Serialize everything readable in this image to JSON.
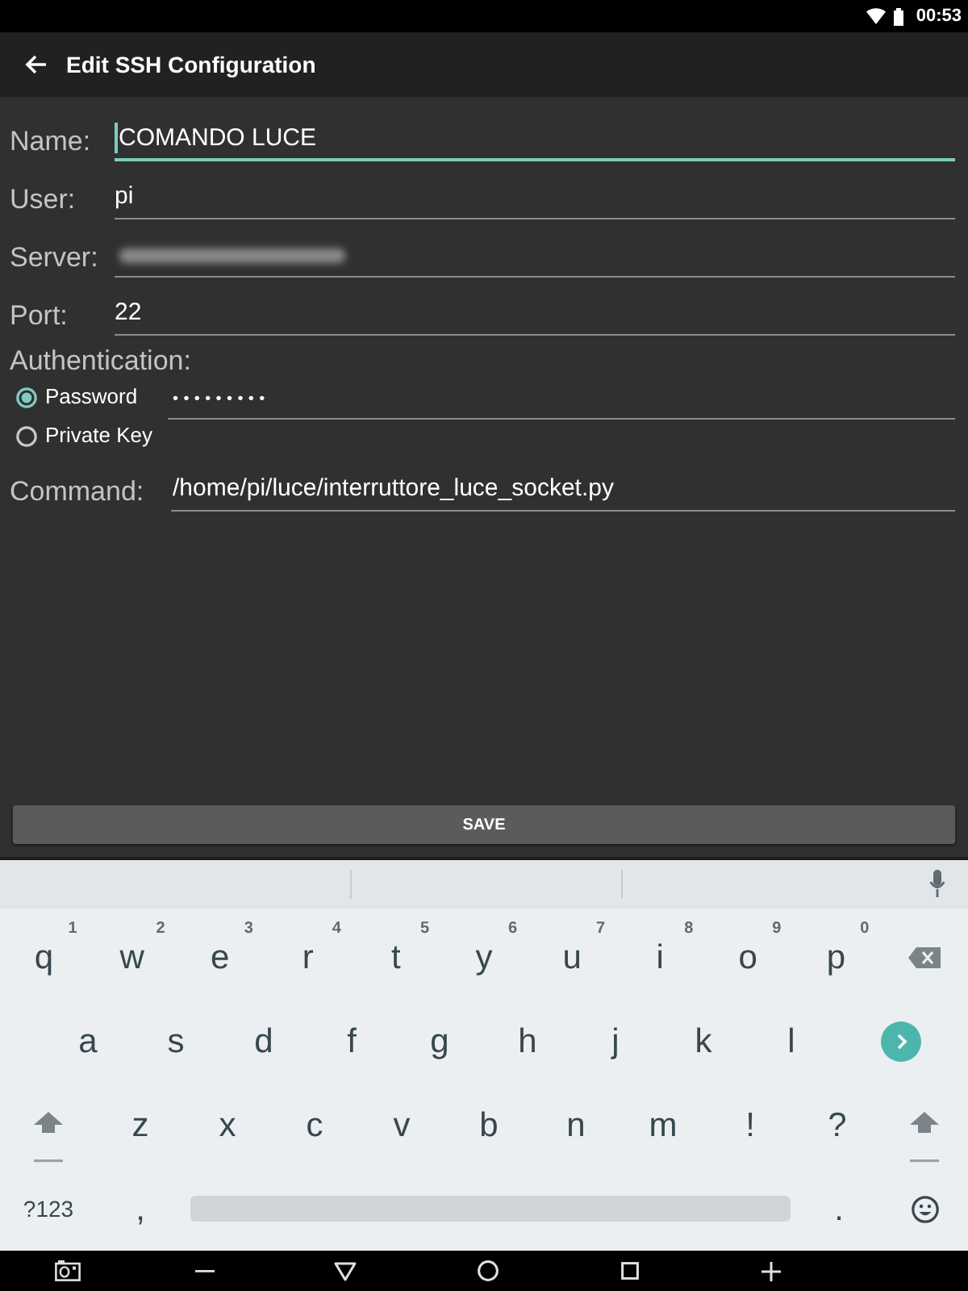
{
  "status_bar": {
    "time": "00:53"
  },
  "toolbar": {
    "title": "Edit SSH Configuration"
  },
  "fields": [
    {
      "label": "Name:",
      "value": "COMANDO LUCE",
      "focused": true,
      "blurred": false
    },
    {
      "label": "User:",
      "value": "pi",
      "focused": false,
      "blurred": false
    },
    {
      "label": "Server:",
      "focused": false,
      "blurred": true
    },
    {
      "label": "Port:",
      "value": "22",
      "focused": false,
      "blurred": false
    }
  ],
  "authentication": {
    "label": "Authentication:",
    "options": [
      {
        "label": "Password",
        "selected": true
      },
      {
        "label": "Private Key",
        "selected": false
      }
    ],
    "password": "•••••••••"
  },
  "command": {
    "label": "Command:",
    "value": "/home/pi/luce/interruttore_luce_socket.py"
  },
  "save_button": "SAVE",
  "keyboard": {
    "key_rows": [
      {
        "keys": [
          {
            "kind": "char",
            "label": "q",
            "hint": "1"
          },
          {
            "kind": "char",
            "label": "w",
            "hint": "2"
          },
          {
            "kind": "char",
            "label": "e",
            "hint": "3"
          },
          {
            "kind": "char",
            "label": "r",
            "hint": "4"
          },
          {
            "kind": "char",
            "label": "t",
            "hint": "5"
          },
          {
            "kind": "char",
            "label": "y",
            "hint": "6"
          },
          {
            "kind": "char",
            "label": "u",
            "hint": "7"
          },
          {
            "kind": "char",
            "label": "i",
            "hint": "8"
          },
          {
            "kind": "char",
            "label": "o",
            "hint": "9"
          },
          {
            "kind": "char",
            "label": "p",
            "hint": "0"
          },
          {
            "kind": "backspace"
          }
        ]
      },
      {
        "keys": [
          {
            "kind": "char",
            "label": "a"
          },
          {
            "kind": "char",
            "label": "s"
          },
          {
            "kind": "char",
            "label": "d"
          },
          {
            "kind": "char",
            "label": "f"
          },
          {
            "kind": "char",
            "label": "g"
          },
          {
            "kind": "char",
            "label": "h"
          },
          {
            "kind": "char",
            "label": "j"
          },
          {
            "kind": "char",
            "label": "k"
          },
          {
            "kind": "char",
            "label": "l"
          },
          {
            "kind": "go"
          }
        ]
      },
      {
        "keys": [
          {
            "kind": "shift"
          },
          {
            "kind": "char",
            "label": "z"
          },
          {
            "kind": "char",
            "label": "x"
          },
          {
            "kind": "char",
            "label": "c"
          },
          {
            "kind": "char",
            "label": "v"
          },
          {
            "kind": "char",
            "label": "b"
          },
          {
            "kind": "char",
            "label": "n"
          },
          {
            "kind": "char",
            "label": "m"
          },
          {
            "kind": "char",
            "label": "!"
          },
          {
            "kind": "char",
            "label": "?"
          },
          {
            "kind": "shift"
          }
        ]
      },
      {
        "keys": [
          {
            "kind": "text",
            "label": "?123"
          },
          {
            "kind": "char",
            "label": ","
          },
          {
            "kind": "space"
          },
          {
            "kind": "char",
            "label": "."
          },
          {
            "kind": "emoji"
          }
        ]
      }
    ]
  }
}
